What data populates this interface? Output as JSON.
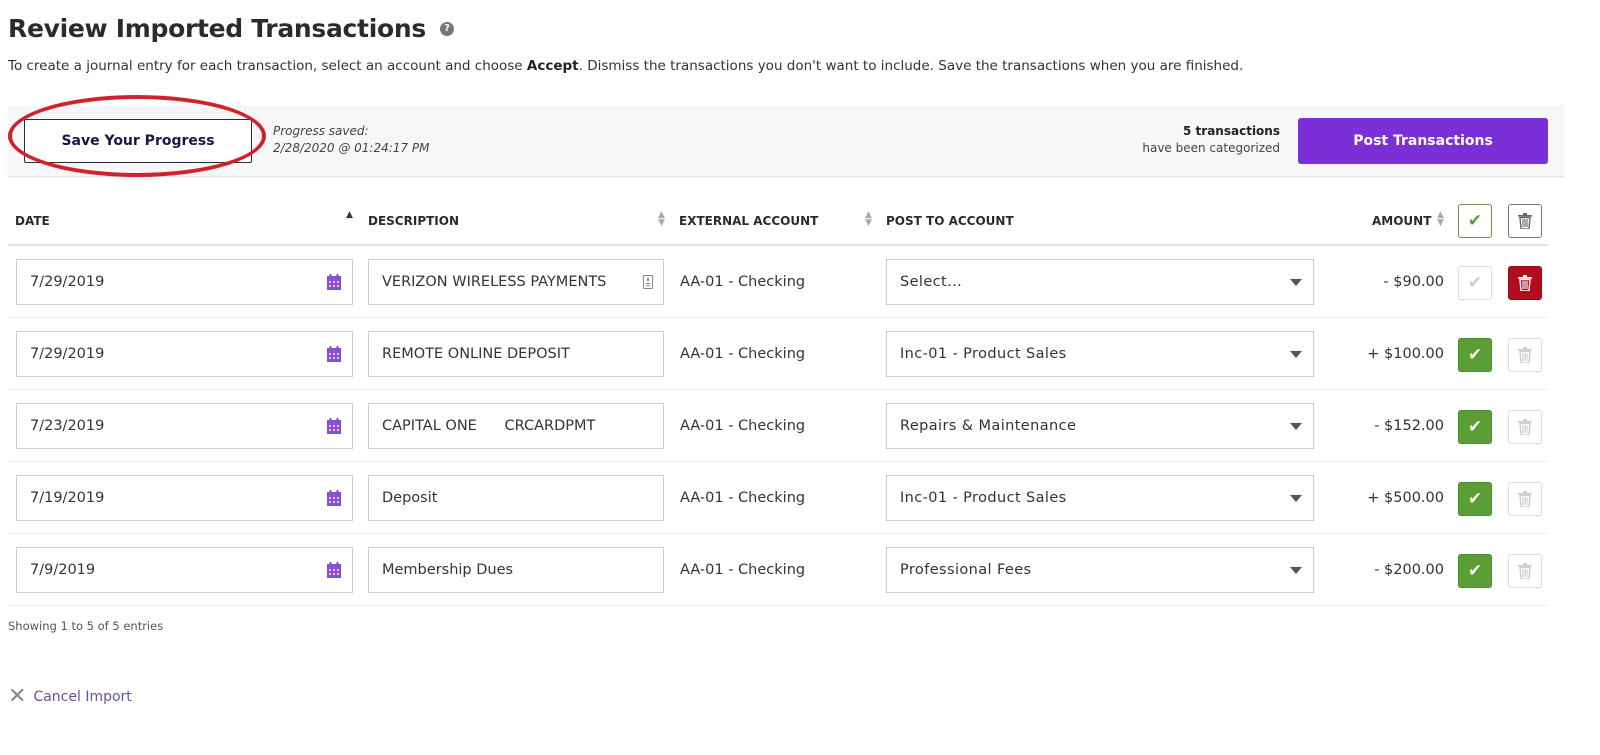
{
  "header": {
    "title": "Review Imported Transactions",
    "help_icon": "question-circle-icon",
    "subtitle_pre": "To create a journal entry for each transaction, select an account and choose ",
    "subtitle_bold": "Accept",
    "subtitle_post": ". Dismiss the transactions you don't want to include. Save the transactions when you are finished."
  },
  "toolbar": {
    "save_label": "Save Your Progress",
    "progress_label": "Progress saved:",
    "progress_time": "2/28/2020 @ 01:24:17 PM",
    "count_strong": "5 transactions",
    "count_rest": "have been categorized",
    "post_label": "Post Transactions"
  },
  "colors": {
    "accent_purple": "#7b2fd6",
    "accept_green": "#5a9e35",
    "dismiss_red": "#b00e1e",
    "annotation_ring": "#d0222c"
  },
  "table": {
    "columns": {
      "date": "DATE",
      "description": "DESCRIPTION",
      "external_account": "EXTERNAL ACCOUNT",
      "post_to_account": "POST TO ACCOUNT",
      "amount": "AMOUNT"
    },
    "rows": [
      {
        "date": "7/29/2019",
        "description": "VERIZON WIRELESS PAYMENTS",
        "has_note": true,
        "external_account": "AA-01 - Checking",
        "post_to": "Select...",
        "amount": "- $90.00",
        "accepted": false,
        "dismissed": true
      },
      {
        "date": "7/29/2019",
        "description": "REMOTE ONLINE DEPOSIT",
        "has_note": false,
        "external_account": "AA-01 - Checking",
        "post_to": "Inc-01 - Product Sales",
        "amount": "+ $100.00",
        "accepted": true,
        "dismissed": false
      },
      {
        "date": "7/23/2019",
        "description": "CAPITAL ONE      CRCARDPMT",
        "has_note": false,
        "external_account": "AA-01 - Checking",
        "post_to": "Repairs & Maintenance",
        "amount": "- $152.00",
        "accepted": true,
        "dismissed": false
      },
      {
        "date": "7/19/2019",
        "description": "Deposit",
        "has_note": false,
        "external_account": "AA-01 - Checking",
        "post_to": "Inc-01 - Product Sales",
        "amount": "+ $500.00",
        "accepted": true,
        "dismissed": false
      },
      {
        "date": "7/9/2019",
        "description": "Membership Dues",
        "has_note": false,
        "external_account": "AA-01 - Checking",
        "post_to": "Professional Fees",
        "amount": "- $200.00",
        "accepted": true,
        "dismissed": false
      }
    ]
  },
  "footer": {
    "entries_info": "Showing 1 to 5 of 5 entries",
    "cancel_label": "Cancel Import"
  }
}
